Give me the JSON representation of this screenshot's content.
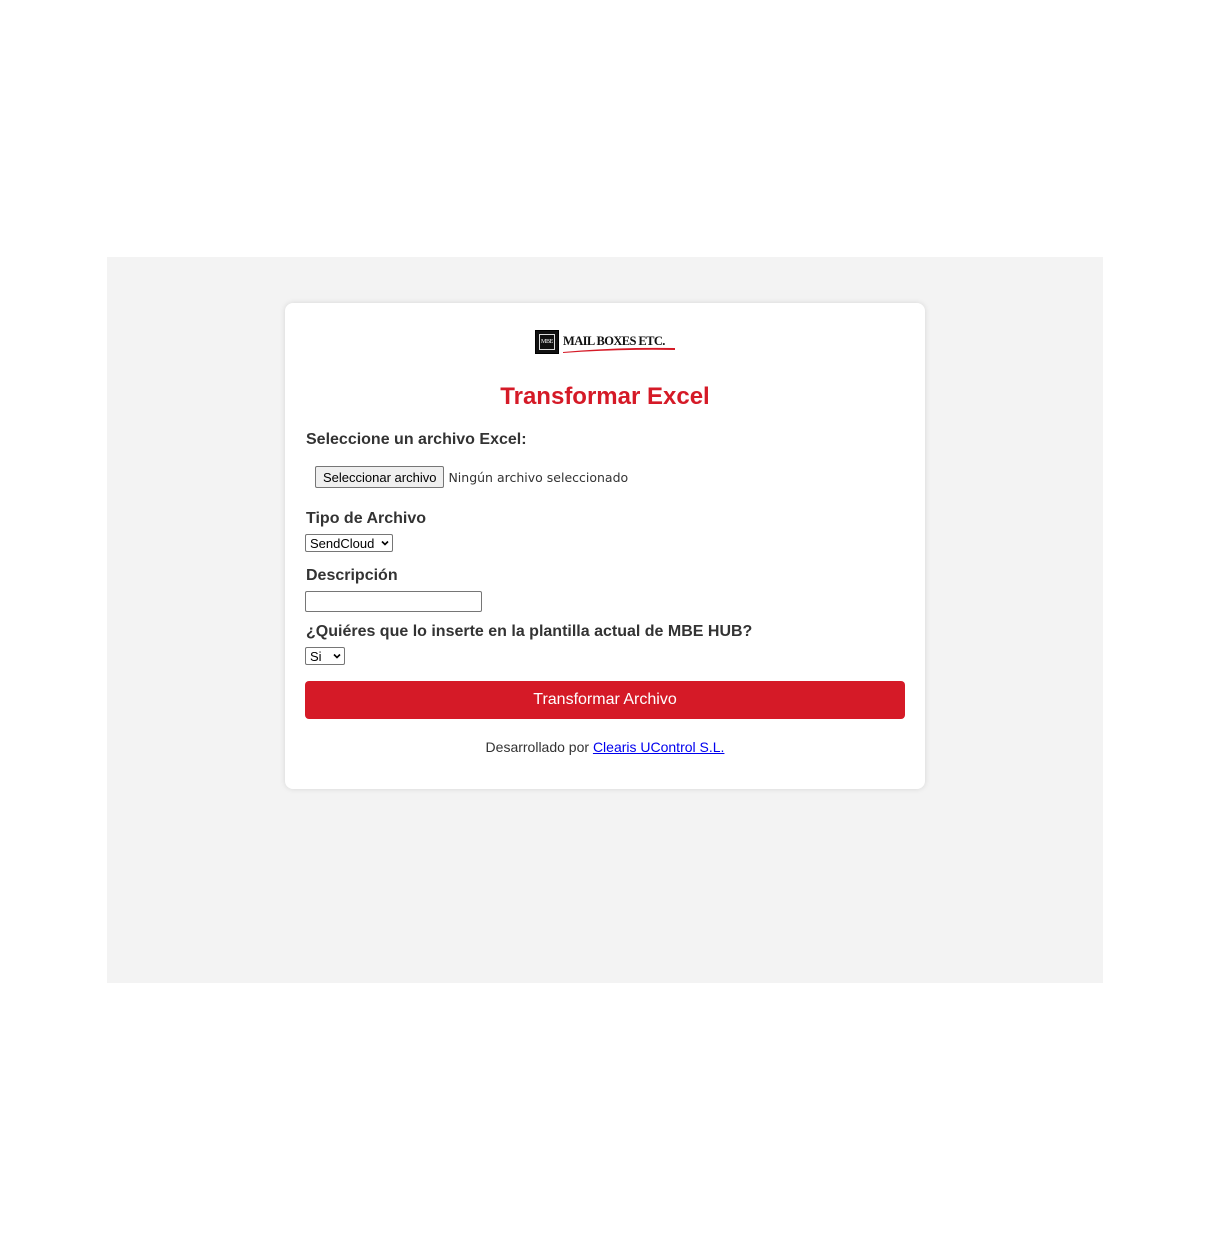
{
  "logo": {
    "box_text": "MBE",
    "brand_text": "MAIL BOXES ETC.",
    "accent_color": "#d51a27"
  },
  "title": "Transformar Excel",
  "file_section": {
    "label": "Seleccione un archivo Excel:",
    "button_label": "Seleccionar archivo",
    "status": "Ningún archivo seleccionado"
  },
  "tipo": {
    "label": "Tipo de Archivo",
    "selected": "SendCloud"
  },
  "descripcion": {
    "label": "Descripción",
    "value": ""
  },
  "plantilla": {
    "label": "¿Quiéres que lo inserte en la plantilla actual de MBE HUB?",
    "selected": "Si"
  },
  "submit_label": "Transformar Archivo",
  "footer": {
    "prefix": "Desarrollado por",
    "link_text": "Clearis UControl S.L."
  },
  "colors": {
    "primary": "#d51a27",
    "backdrop": "#f3f3f3",
    "link": "#0000ee"
  }
}
